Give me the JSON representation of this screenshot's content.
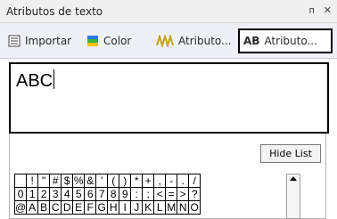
{
  "window": {
    "title": "Atributos de texto",
    "pin_icon": "pin-icon",
    "close_icon": "close-icon"
  },
  "tabs": [
    {
      "label": "Importar",
      "icon": "import-icon"
    },
    {
      "label": "Color",
      "icon": "color-icon"
    },
    {
      "label": "Atributo...",
      "icon": "pattern-icon"
    },
    {
      "label": "Atributo...",
      "icon": "text-attribute-icon",
      "icon_text": "AB"
    }
  ],
  "text_input": {
    "value": "ABC"
  },
  "hide_list_button": {
    "label": "Hide List"
  },
  "char_rows": [
    [
      " ",
      "!",
      "\"",
      "#",
      "$",
      "%",
      "&",
      "'",
      "(",
      ")",
      "*",
      "+",
      ",",
      "-",
      ".",
      "/"
    ],
    [
      "0",
      "1",
      "2",
      "3",
      "4",
      "5",
      "6",
      "7",
      "8",
      "9",
      ":",
      ";",
      "<",
      "=",
      ">",
      "?"
    ],
    [
      "@",
      "A",
      "B",
      "C",
      "D",
      "E",
      "F",
      "G",
      "H",
      "I",
      "J",
      "K",
      "L",
      "M",
      "N",
      "O"
    ]
  ]
}
